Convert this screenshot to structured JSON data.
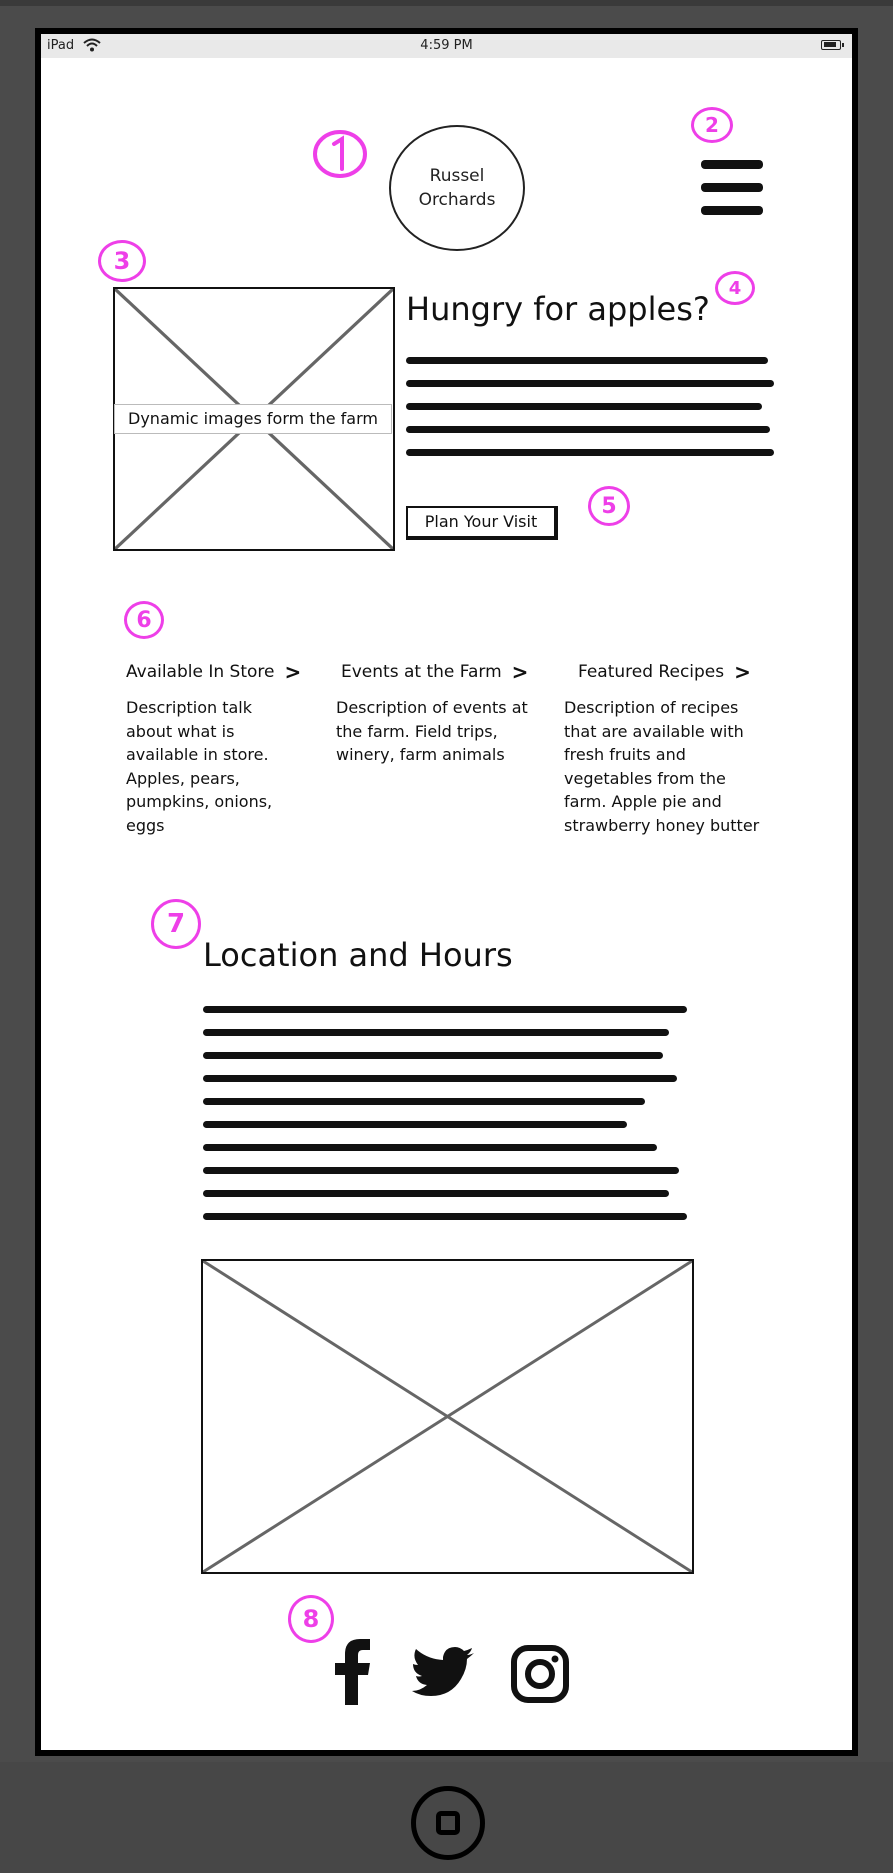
{
  "status_bar": {
    "carrier": "iPad",
    "time": "4:59 PM"
  },
  "header": {
    "logo_text_line1": "Russel",
    "logo_text_line2": "Orchards",
    "menu_icon": "hamburger-menu-icon"
  },
  "annotations": [
    "1",
    "2",
    "3",
    "4",
    "5",
    "6",
    "7",
    "8"
  ],
  "hero": {
    "image_caption": "Dynamic images form the farm",
    "heading": "Hungry for apples?",
    "cta_label": "Plan Your Visit"
  },
  "features": [
    {
      "title": "Available In Store",
      "description": "Description talk about what is available in store. Apples, pears, pumpkins, onions, eggs"
    },
    {
      "title": "Events at the Farm",
      "description": "Description of events at the farm. Field trips, winery, farm animals"
    },
    {
      "title": "Featured Recipes",
      "description": "Description of recipes that are available with fresh fruits and vegetables from the farm. Apple pie and strawberry honey butter"
    }
  ],
  "location": {
    "heading": "Location and Hours"
  },
  "social": [
    {
      "icon": "facebook-icon"
    },
    {
      "icon": "twitter-icon"
    },
    {
      "icon": "instagram-icon"
    }
  ],
  "colors": {
    "annotation": "#ee3fe8",
    "device": "#4b4b4b",
    "ink": "#111111"
  }
}
